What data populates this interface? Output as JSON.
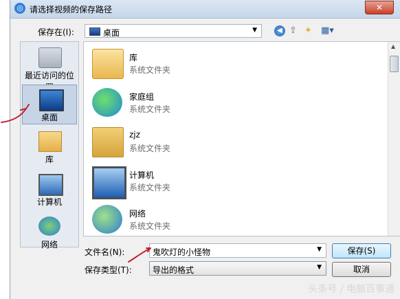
{
  "window": {
    "title": "请选择视频的保存路径",
    "close_glyph": "✕"
  },
  "toolbar": {
    "save_in_label": "保存在(I):",
    "save_in_value": "桌面",
    "back_glyph": "◀",
    "up_glyph": "⇧",
    "newfolder_glyph": "✦",
    "view_glyph": "▦▾"
  },
  "places": [
    {
      "label": "最近访问的位置",
      "icon": "recent-places-icon"
    },
    {
      "label": "桌面",
      "icon": "desktop-icon",
      "selected": true
    },
    {
      "label": "库",
      "icon": "library-icon"
    },
    {
      "label": "计算机",
      "icon": "computer-icon"
    },
    {
      "label": "网络",
      "icon": "network-icon"
    }
  ],
  "files": [
    {
      "name": "库",
      "type": "系统文件夹",
      "icon": "library-icon"
    },
    {
      "name": "家庭组",
      "type": "系统文件夹",
      "icon": "homegroup-icon"
    },
    {
      "name": "zjz",
      "type": "系统文件夹",
      "icon": "user-folder-icon"
    },
    {
      "name": "计算机",
      "type": "系统文件夹",
      "icon": "computer-icon"
    },
    {
      "name": "网络",
      "type": "系统文件夹",
      "icon": "network-icon"
    }
  ],
  "form": {
    "filename_label": "文件名(N):",
    "filename_value": "鬼吹灯的小怪物",
    "filetype_label": "保存类型(T):",
    "filetype_value": "导出的格式"
  },
  "buttons": {
    "save": "保存(S)",
    "cancel": "取消"
  },
  "watermark": "头条号 / 电脑百事通"
}
